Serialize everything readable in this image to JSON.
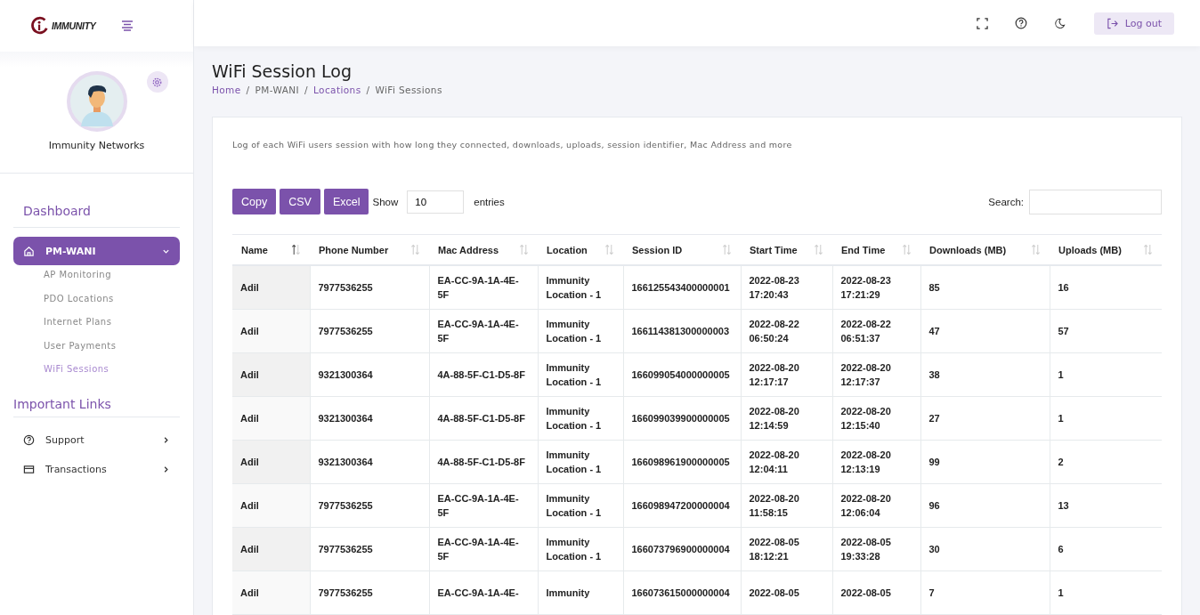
{
  "brand": {
    "logo_text": "IMMUNITY"
  },
  "header": {
    "logout_label": "Log out"
  },
  "profile": {
    "name": "Immunity Networks"
  },
  "sidebar": {
    "sections": [
      {
        "title": "Dashboard",
        "items": [
          {
            "label": "PM-WANI",
            "selected": true,
            "expanded": true,
            "children": [
              {
                "label": "AP Monitoring",
                "selected": false
              },
              {
                "label": "PDO Locations",
                "selected": false
              },
              {
                "label": "Internet Plans",
                "selected": false
              },
              {
                "label": "User Payments",
                "selected": false
              },
              {
                "label": "WiFi Sessions",
                "selected": true
              }
            ]
          }
        ]
      },
      {
        "title": "Important Links",
        "items": [
          {
            "label": "Support",
            "selected": false,
            "expanded": false
          },
          {
            "label": "Transactions",
            "selected": false,
            "expanded": false
          }
        ]
      }
    ]
  },
  "page": {
    "title": "WiFi Session Log",
    "breadcrumb": [
      {
        "label": "Home",
        "kind": "link"
      },
      {
        "label": "/",
        "kind": "separator"
      },
      {
        "label": "PM-WANI",
        "kind": "text"
      },
      {
        "label": "/",
        "kind": "separator"
      },
      {
        "label": "Locations",
        "kind": "link"
      },
      {
        "label": "/",
        "kind": "separator"
      },
      {
        "label": "WiFi Sessions",
        "kind": "text"
      }
    ],
    "description": "Log of each WiFi users session with how long they connected, downloads, uploads, session identifier, Mac Address and more"
  },
  "toolbar": {
    "buttons": [
      "Copy",
      "CSV",
      "Excel"
    ],
    "show_label": "Show",
    "entries_value": "10",
    "entries_label": "entries",
    "search_label": "Search:"
  },
  "table": {
    "columns": [
      {
        "label": "Name",
        "sorted": true
      },
      {
        "label": "Phone Number",
        "sorted": false
      },
      {
        "label": "Mac Address",
        "sorted": false
      },
      {
        "label": "Location",
        "sorted": false
      },
      {
        "label": "Session ID",
        "sorted": false
      },
      {
        "label": "Start Time",
        "sorted": false
      },
      {
        "label": "End Time",
        "sorted": false
      },
      {
        "label": "Downloads (MB)",
        "sorted": false
      },
      {
        "label": "Uploads (MB)",
        "sorted": false
      }
    ],
    "rows": [
      [
        "Adil",
        "7977536255",
        "EA-CC-9A-1A-4E-5F",
        "Immunity Location - 1",
        "166125543400000001",
        "2022-08-23 17:20:43",
        "2022-08-23 17:21:29",
        "85",
        "16"
      ],
      [
        "Adil",
        "7977536255",
        "EA-CC-9A-1A-4E-5F",
        "Immunity Location - 1",
        "166114381300000003",
        "2022-08-22 06:50:24",
        "2022-08-22 06:51:37",
        "47",
        "57"
      ],
      [
        "Adil",
        "9321300364",
        "4A-88-5F-C1-D5-8F",
        "Immunity Location - 1",
        "166099054000000005",
        "2022-08-20 12:17:17",
        "2022-08-20 12:17:37",
        "38",
        "1"
      ],
      [
        "Adil",
        "9321300364",
        "4A-88-5F-C1-D5-8F",
        "Immunity Location - 1",
        "166099039900000005",
        "2022-08-20 12:14:59",
        "2022-08-20 12:15:40",
        "27",
        "1"
      ],
      [
        "Adil",
        "9321300364",
        "4A-88-5F-C1-D5-8F",
        "Immunity Location - 1",
        "166098961900000005",
        "2022-08-20 12:04:11",
        "2022-08-20 12:13:19",
        "99",
        "2"
      ],
      [
        "Adil",
        "7977536255",
        "EA-CC-9A-1A-4E-5F",
        "Immunity Location - 1",
        "166098947200000004",
        "2022-08-20 11:58:15",
        "2022-08-20 12:06:04",
        "96",
        "13"
      ],
      [
        "Adil",
        "7977536255",
        "EA-CC-9A-1A-4E-5F",
        "Immunity Location - 1",
        "166073796900000004",
        "2022-08-05 18:12:21",
        "2022-08-05 19:33:28",
        "30",
        "6"
      ],
      [
        "Adil",
        "7977536255",
        "EA-CC-9A-1A-4E-",
        "Immunity",
        "166073615000000004",
        "2022-08-05",
        "2022-08-05",
        "7",
        "1"
      ]
    ]
  }
}
